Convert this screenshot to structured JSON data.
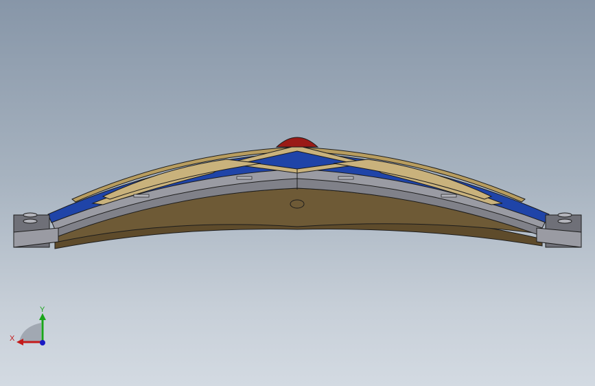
{
  "viewport": {
    "background_top": "#8796a8",
    "background_bottom": "#d3dae2"
  },
  "model": {
    "colors": {
      "blue_band": "#1f44a8",
      "gold_inlay": "#c9b27c",
      "gold_trim": "#b89d5f",
      "gray_side": "#6f7078",
      "gray_light": "#9a9ba3",
      "bronze_base": "#6e5a36",
      "red_gem": "#9a1a16",
      "outline": "#1c1c1c"
    }
  },
  "triad": {
    "x_label": "X",
    "y_label": "Y",
    "x_color": "#c41a1a",
    "y_color": "#1aa51a",
    "z_color": "#1a1ac4"
  }
}
